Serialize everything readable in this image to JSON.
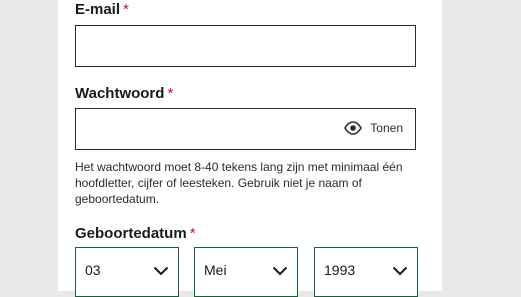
{
  "email": {
    "label": "E-mail",
    "required_mark": "*",
    "value": ""
  },
  "password": {
    "label": "Wachtwoord",
    "required_mark": "*",
    "value": "",
    "toggle_icon": "eye-icon",
    "toggle_label": "Tonen",
    "hint": "Het wachtwoord moet 8-40 tekens lang zijn met minimaal één hoofdletter, cijfer of leesteken. Gebruik niet je naam of geboortedatum."
  },
  "birthdate": {
    "label": "Geboortedatum",
    "required_mark": "*",
    "day": "03",
    "month": "Mei",
    "year": "1993"
  },
  "colors": {
    "required": "#c8102e",
    "select_border": "#1f5a3c",
    "input_border": "#2b2b2b",
    "background": "#e9e9e9"
  }
}
